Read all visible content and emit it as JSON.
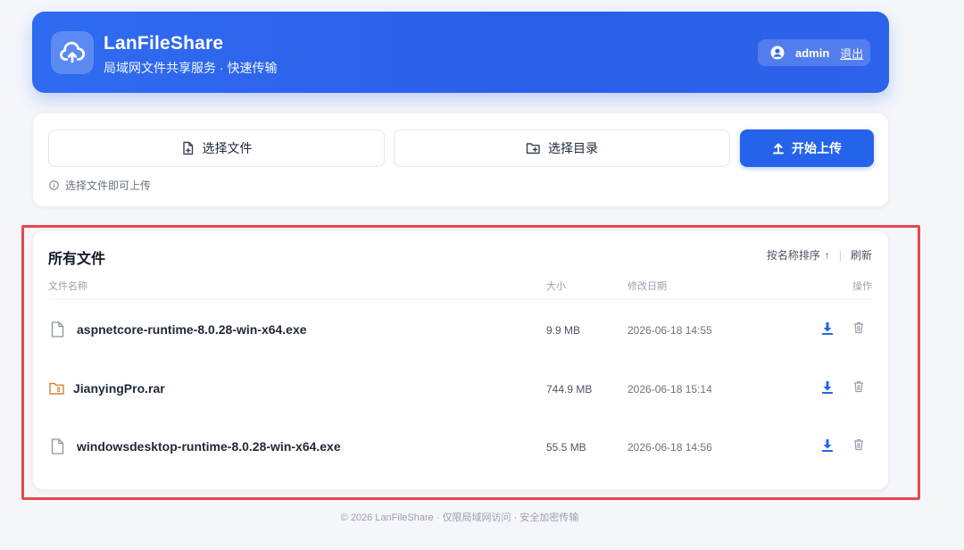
{
  "header": {
    "title": "LanFileShare",
    "subtitle": "局域网文件共享服务 · 快速传输",
    "logo_icon": "cloud-upload-icon",
    "user": {
      "icon": "user-circle-icon",
      "name": "admin",
      "logout_label": "退出"
    }
  },
  "upload": {
    "choose_files_label": "选择文件",
    "choose_dir_label": "选择目录",
    "start_upload_label": "开始上传",
    "hint": "选择文件即可上传"
  },
  "files": {
    "title": "所有文件",
    "sort_label": "按名称排序",
    "sort_arrow": "↑",
    "sort_separator": "|",
    "refresh_label": "刷新",
    "columns": {
      "name": "文件名称",
      "size": "大小",
      "date": "修改日期",
      "actions": "操作"
    },
    "rows": [
      {
        "name": "aspnetcore-runtime-8.0.28-win-x64.exe",
        "size": "9.9 MB",
        "date": "2026-06-18 14:55",
        "type": "file"
      },
      {
        "name": "JianyingPro.rar",
        "size": "744.9 MB",
        "date": "2026-06-18 15:14",
        "type": "archive"
      },
      {
        "name": "windowsdesktop-runtime-8.0.28-win-x64.exe",
        "size": "55.5 MB",
        "date": "2026-06-18 14:56",
        "type": "file"
      }
    ]
  },
  "footer": {
    "text": "© 2026 LanFileShare · 仅限局域网访问 · 安全加密传输"
  },
  "colors": {
    "primary": "#2563eb",
    "header_gradient_start": "#2f6bf0",
    "highlight": "#e5484d",
    "archive_icon": "#d9822b"
  }
}
